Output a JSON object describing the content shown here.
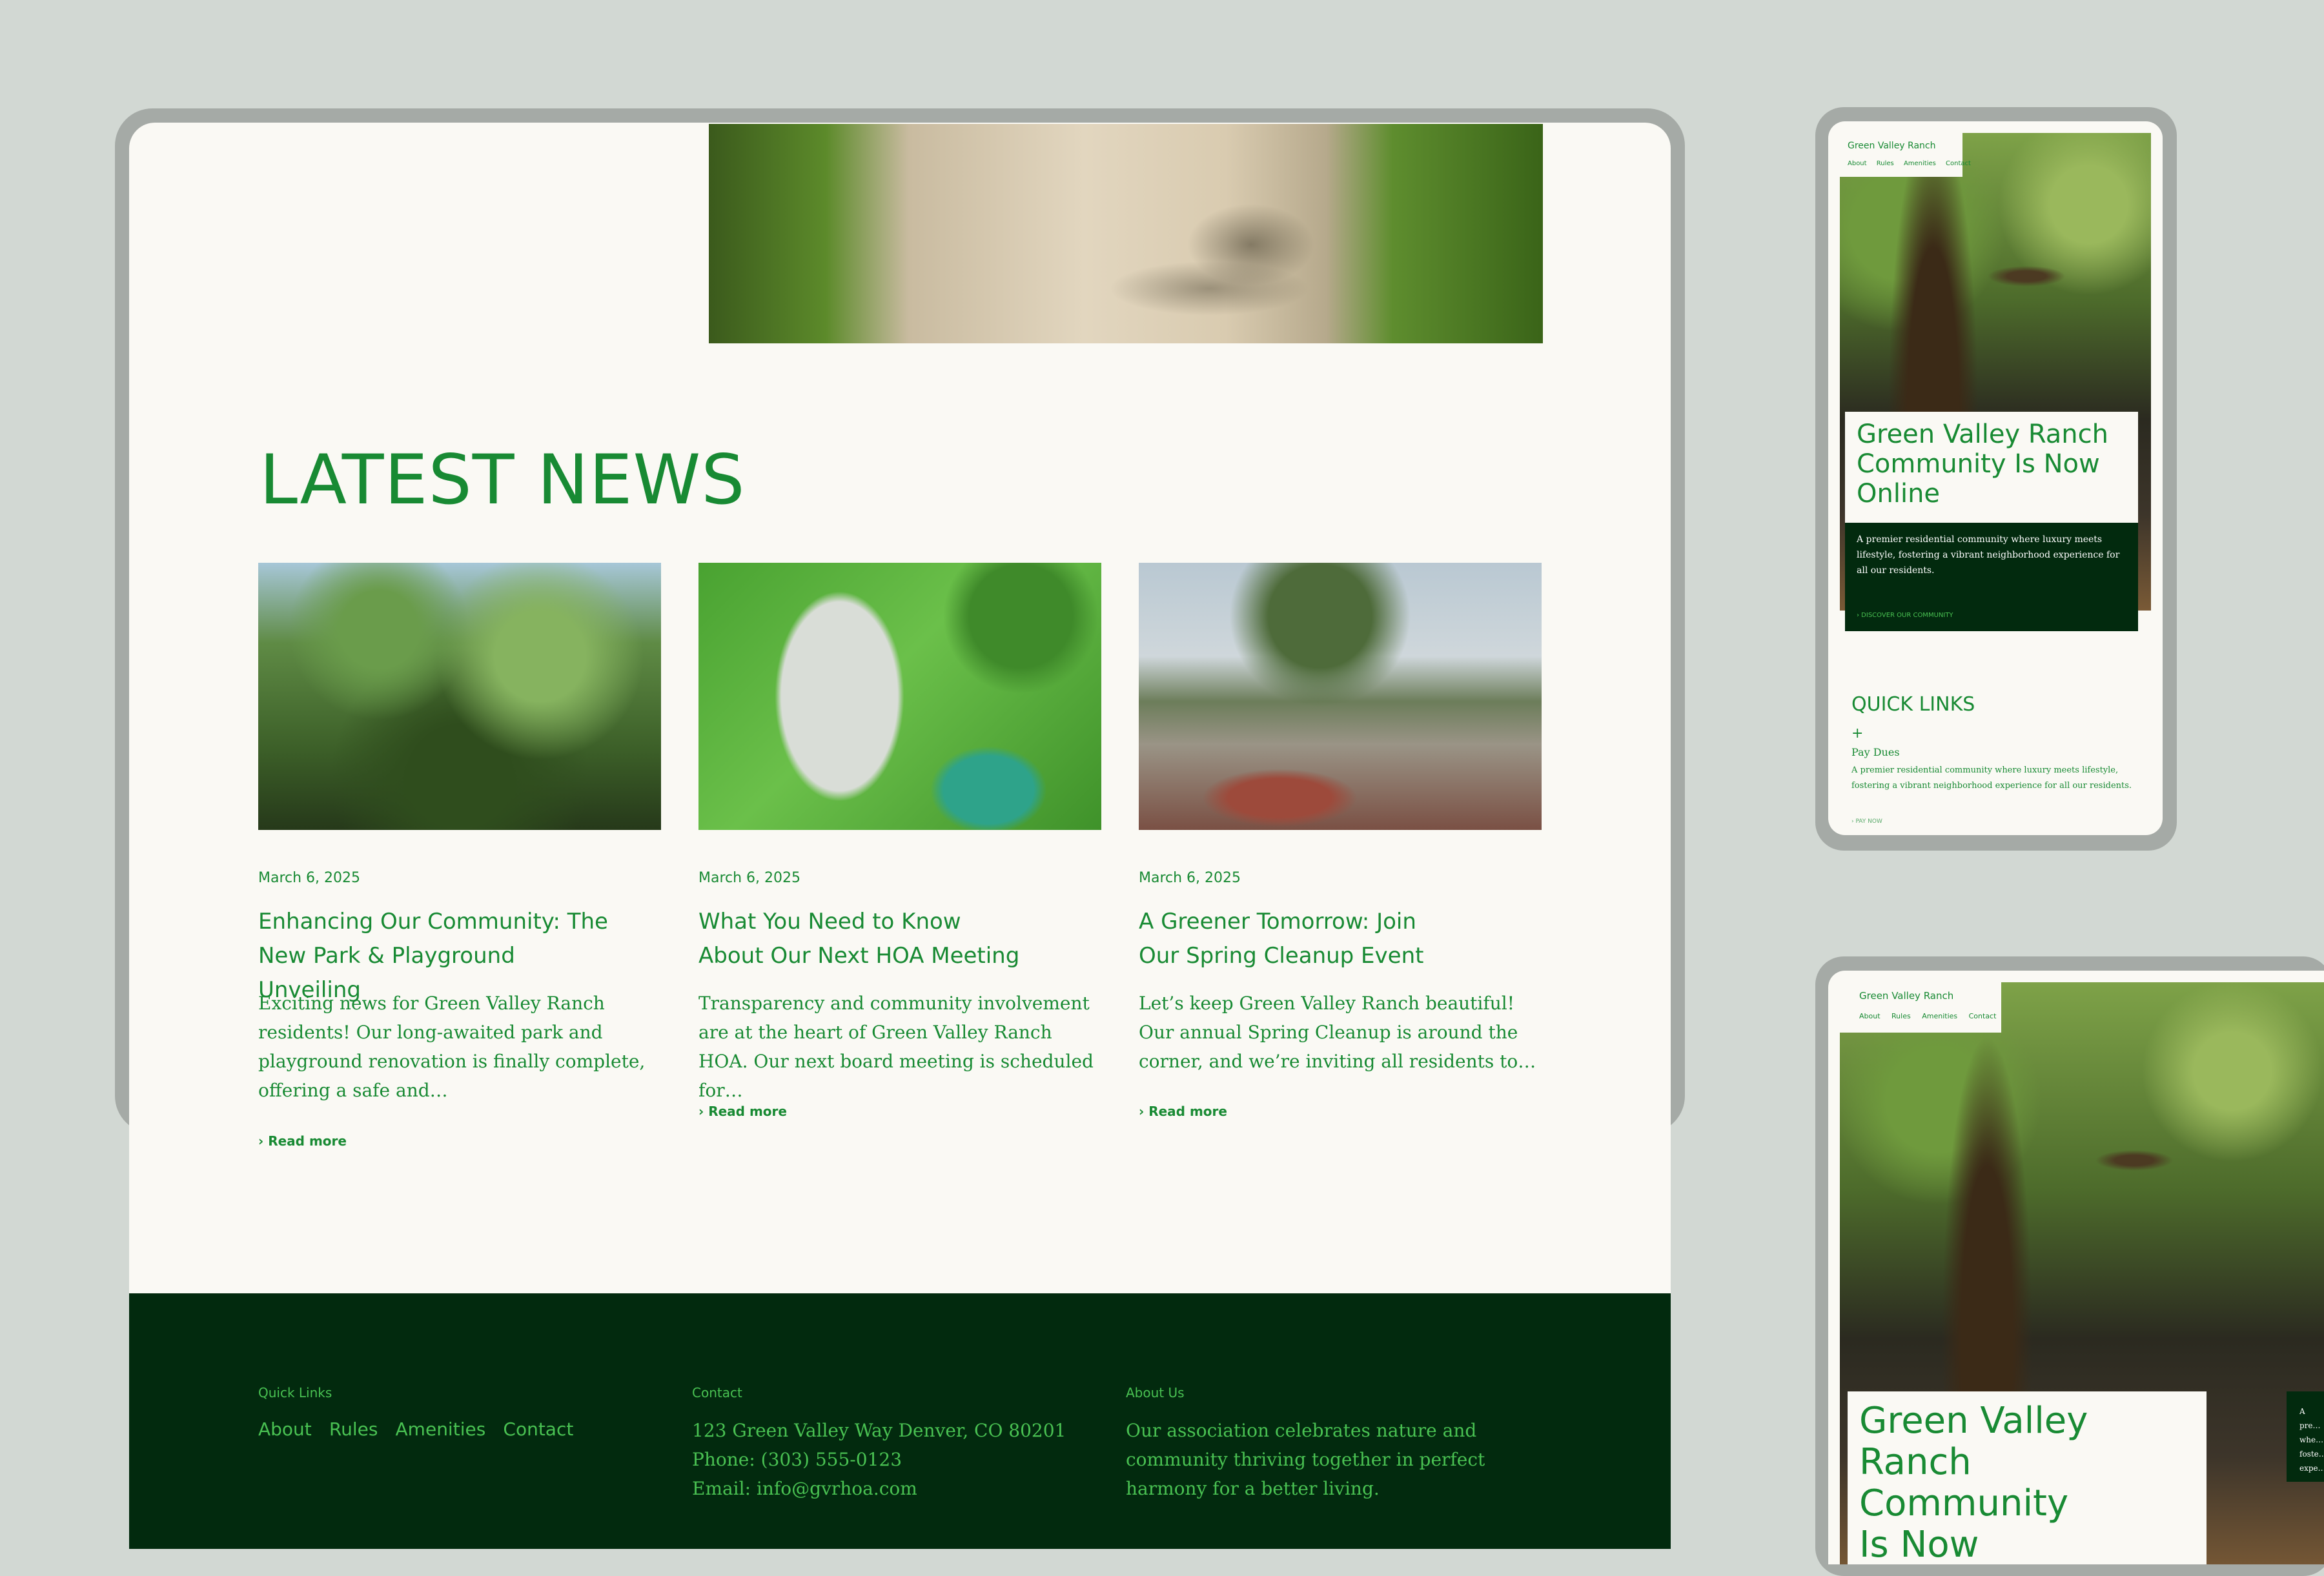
{
  "main": {
    "section_title": "LATEST NEWS",
    "cards": [
      {
        "date": "March 6, 2025",
        "title_line1": "Enhancing Our Community: The",
        "title_line2": "New Park & Playground Unveiling",
        "excerpt": "Exciting news for Green Valley Ranch residents! Our long-awaited park and playground renovation is finally complete, offering a safe and…",
        "link": "› Read more"
      },
      {
        "date": "March 6, 2025",
        "title_line1": "What You Need to Know",
        "title_line2": "About Our Next HOA Meeting",
        "excerpt": "Transparency and community involvement are at the heart of Green Valley Ranch HOA. Our next board meeting is scheduled for…",
        "link": "› Read more"
      },
      {
        "date": "March 6, 2025",
        "title_line1": "A Greener Tomorrow: Join",
        "title_line2": "Our Spring Cleanup Event",
        "excerpt": "Let’s keep Green Valley Ranch beautiful! Our annual Spring Cleanup is around the corner, and we’re inviting all residents to…",
        "link": "› Read more"
      }
    ]
  },
  "footer": {
    "quick_links_heading": "Quick Links",
    "links": [
      "About",
      "Rules",
      "Amenities",
      "Contact"
    ],
    "contact_heading": "Contact",
    "address": "123 Green Valley Way Denver, CO 80201",
    "phone": "Phone: (303) 555-0123",
    "email": "Email: info@gvrhoa.com",
    "about_heading": "About Us",
    "about_text": "Our association celebrates nature and community thriving together in perfect harmony for a better living."
  },
  "mobile": {
    "brand": "Green Valley Ranch",
    "nav": [
      "About",
      "Rules",
      "Amenities",
      "Contact"
    ],
    "hero_title": "Green Valley Ranch Community Is Now Online",
    "hero_text": "A premier residential community where luxury meets lifestyle, fostering a vibrant neighborhood experience for all our residents.",
    "hero_cta": "› DISCOVER OUR COMMUNITY",
    "quick_links_title": "QUICK LINKS",
    "plus": "+",
    "pay_dues_title": "Pay Dues",
    "pay_dues_text": "A premier residential community where luxury meets lifestyle, fostering a vibrant neighborhood experience for all our residents.",
    "pay_now": "› PAY NOW"
  },
  "tablet": {
    "brand": "Green Valley Ranch",
    "nav": [
      "About",
      "Rules",
      "Amenities",
      "Contact"
    ],
    "hero_title": "Green Valley Ranch Community Is Now Online",
    "hero_text_partial": "A pre… whe… foste… expe…"
  },
  "colors": {
    "accent": "#188a33",
    "footer_bg": "#022a0e",
    "page_bg": "#faf9f4",
    "frame": "#a5aaa6",
    "backdrop": "#d2d8d3"
  }
}
